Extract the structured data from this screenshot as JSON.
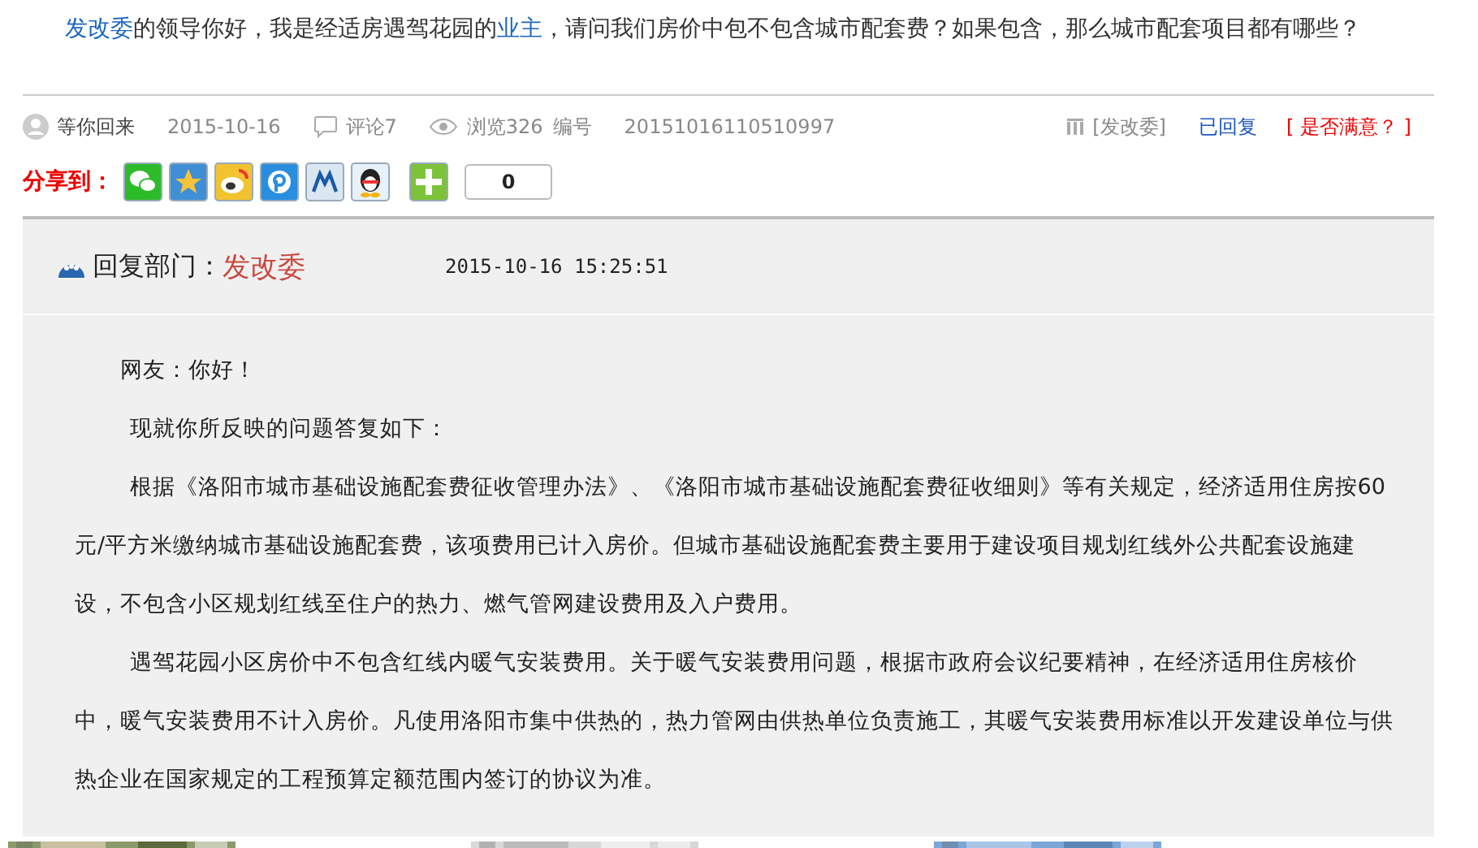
{
  "question": {
    "parts": [
      {
        "text": "发改委",
        "kind": "link"
      },
      {
        "text": "的领导你好，我是经适房遇驾花园的",
        "kind": "plain"
      },
      {
        "text": "业主",
        "kind": "link"
      },
      {
        "text": "，请问我们房价中包不包含城市配套费？如果包含，那么城市配套项目都有哪些？",
        "kind": "plain"
      }
    ]
  },
  "meta": {
    "author": "等你回来",
    "date": "2015-10-16",
    "comments": "评论7",
    "views": "浏览326",
    "number_label": "编号",
    "number": "20151016110510997",
    "department": "[发改委]",
    "status": "已回复",
    "satisfaction": "[ 是否满意？ ]"
  },
  "share": {
    "label": "分享到：",
    "services": [
      {
        "kind": "wechat"
      },
      {
        "kind": "qzone"
      },
      {
        "kind": "weibo"
      },
      {
        "kind": "pengyou"
      },
      {
        "kind": "renren"
      },
      {
        "kind": "qq"
      },
      {
        "kind": "more"
      }
    ],
    "count": "0"
  },
  "reply": {
    "label": "回复部门：",
    "department": "发改委",
    "time": "2015-10-16 15:25:51",
    "paragraphs": [
      {
        "text": "网友：你好！",
        "kind": "greeting"
      },
      {
        "text": "现就你所反映的问题答复如下：",
        "kind": "lead"
      },
      {
        "text": "根据《洛阳市城市基础设施配套费征收管理办法》、《洛阳市城市基础设施配套费征收细则》等有关规定，经济适用住房按60元/平方米缴纳城市基础设施配套费，该项费用已计入房价。但城市基础设施配套费主要用于建设项目规划红线外公共配套设施建设，不包含小区规划红线至住户的热力、燃气管网建设费用及入户费用。",
        "kind": "body"
      },
      {
        "text": "遇驾花园小区房价中不包含红线内暖气安装费用。关于暖气安装费用问题，根据市政府会议纪要精神，在经济适用住房核价中，暖气安装费用不计入房价。凡使用洛阳市集中供热的，热力管网由供热单位负责施工，其暖气安装费用标准以开发建设单位与供热企业在国家规定的工程预算定额范围内签订的协议为准。",
        "kind": "body"
      }
    ]
  }
}
